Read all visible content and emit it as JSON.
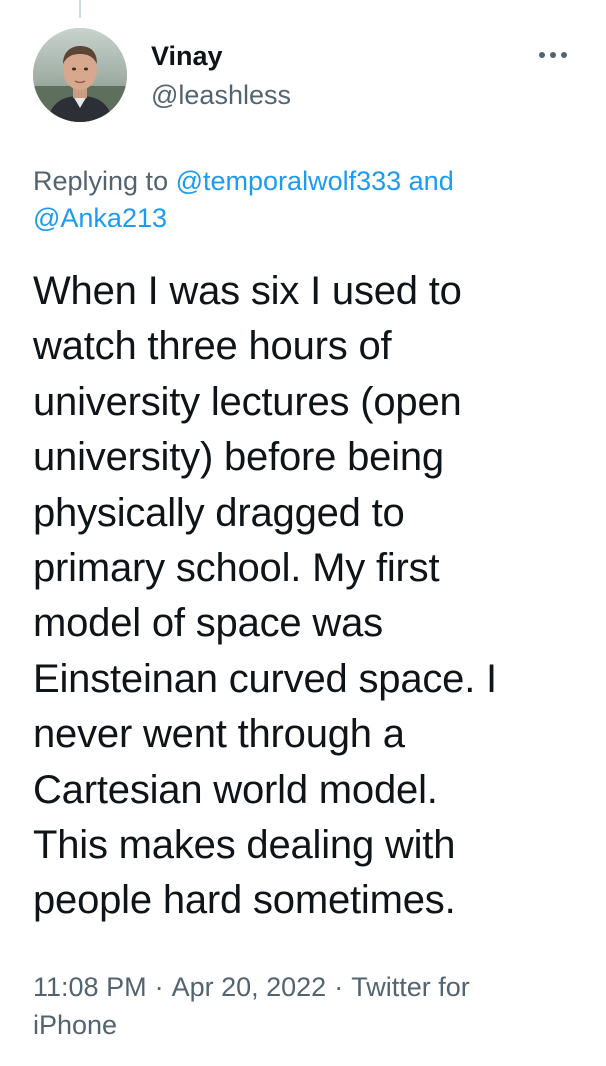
{
  "user": {
    "display_name": "Vinay",
    "handle": "@leashless"
  },
  "icons": {
    "more": "more-horizontal-icon"
  },
  "reply": {
    "prefix": "Replying to",
    "mentions": [
      "@temporalwolf333",
      "@Anka213"
    ],
    "joiner": "and"
  },
  "tweet": {
    "lines": [
      "When I was six I used to",
      "watch three hours of",
      "university lectures (open",
      "university) before being",
      "physically dragged to",
      "primary school. My first",
      "model of space was",
      "Einsteinan curved space. I",
      "never went through a",
      "Cartesian world model.",
      "This makes dealing with",
      "people hard sometimes."
    ]
  },
  "meta": {
    "time": "11:08 PM",
    "date": "Apr 20, 2022",
    "source": "Twitter for iPhone",
    "separator": "·"
  },
  "colors": {
    "text_primary": "#0f1419",
    "text_secondary": "#536471",
    "link": "#1d9bf0"
  }
}
